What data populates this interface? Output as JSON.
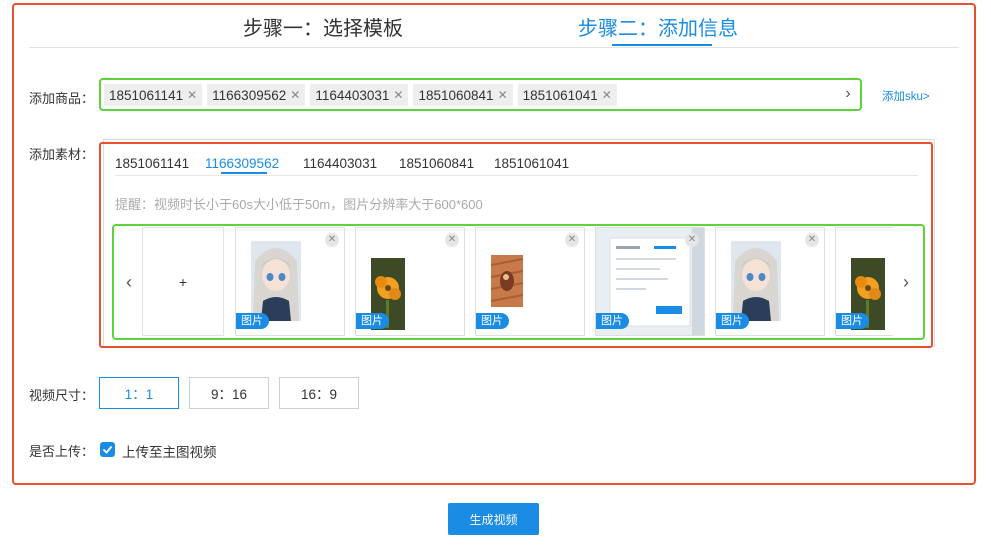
{
  "steps": [
    {
      "label": "步骤一：选择模板"
    },
    {
      "label": "步骤二：添加信息"
    }
  ],
  "form": {
    "product_label": "添加商品：",
    "material_label": "添加素材：",
    "size_label": "视频尺寸：",
    "upload_label": "是否上传："
  },
  "products": [
    "1851061141",
    "1166309562",
    "1164403031",
    "1851060841",
    "1851061041"
  ],
  "add_sku": "添加sku>",
  "material": {
    "tabs": [
      "1851061141",
      "1166309562",
      "1164403031",
      "1851060841",
      "1851061041"
    ],
    "active_tab": "1166309562",
    "tip": "提醒：视频时长小于60s大小低于50m，图片分辨率大于600*600",
    "add_symbol": "+",
    "cards": [
      {
        "badge": "图片",
        "kind": "anime-girl"
      },
      {
        "badge": "图片",
        "kind": "orange-flower"
      },
      {
        "badge": "图片",
        "kind": "wood-photo"
      },
      {
        "badge": "图片",
        "kind": "screenshot"
      },
      {
        "badge": "图片",
        "kind": "anime-girl"
      },
      {
        "badge": "图片",
        "kind": "orange-flower"
      }
    ]
  },
  "sizes": [
    "1：1",
    "9：16",
    "16：9"
  ],
  "active_size": "1：1",
  "upload_option": {
    "label": "上传至主图视频",
    "checked": true
  },
  "generate_button": "生成视频",
  "colors": {
    "accent": "#1a8ce3",
    "highlight_red": "#e8502e",
    "highlight_green": "#5fd33d"
  }
}
